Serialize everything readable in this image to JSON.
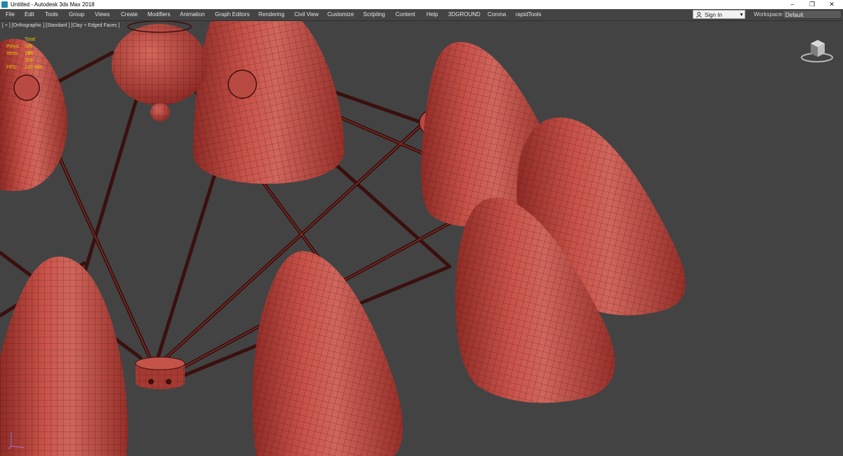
{
  "window": {
    "title": "Untitled - Autodesk 3ds Max 2018",
    "controls": [
      "–",
      "❐",
      "✕"
    ]
  },
  "menu": {
    "items": [
      "File",
      "Edit",
      "Tools",
      "Group",
      "Views",
      "Create",
      "Modifiers",
      "Animation",
      "Graph Editors",
      "Rendering",
      "Civil View",
      "Customize",
      "Scripting",
      "Content",
      "Help",
      "3DGROUND",
      "Corona",
      "rapidTools"
    ],
    "sign_in": "Sign In",
    "workspaces_label": "Workspaces:",
    "workspaces_value": "Default"
  },
  "viewport": {
    "label": "[ + ] [Orthographic ] [Standard ] [Clay + Edged Faces ]",
    "stats": {
      "header": "Total",
      "polys_label": "Polys:",
      "polys_value": "326 148",
      "verts_label": "Verts:",
      "verts_value": "165 356",
      "fps_label": "FPS:",
      "fps_value": "240.888"
    },
    "icons": {
      "viewcube": "viewcube-icon",
      "axis": "axis-tripod-icon",
      "app": "3dsmax-app-icon"
    }
  },
  "colors": {
    "clay": "#c2453d",
    "clay_dark": "#8e2a25",
    "wire": "#3d0f0d",
    "viewport_bg": "#434343",
    "stats": "#e8c400"
  }
}
